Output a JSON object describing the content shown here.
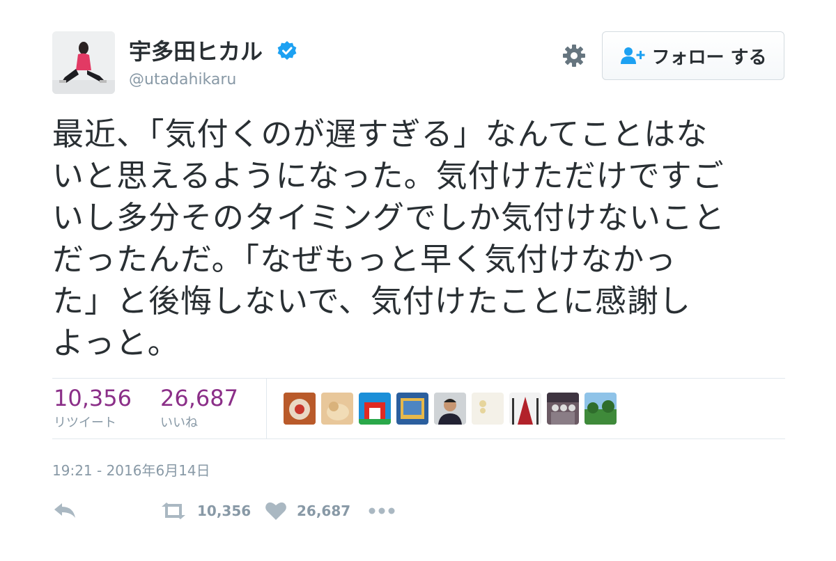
{
  "user": {
    "display_name": "宇多田ヒカル",
    "handle": "@utadahikaru",
    "verified": true
  },
  "follow_button": {
    "label": "フォロー する"
  },
  "tweet": {
    "lines": [
      "最近、「気付くのが遅すぎる」なんてことはな",
      "いと思えるようになった。気付けただけですご",
      "いし多分そのタイミングでしか気付けないこと",
      "だったんだ。「なぜもっと早く気付けなかっ",
      "た」と後悔しないで、気付けたことに感謝し",
      "よっと。"
    ]
  },
  "stats": {
    "retweets": {
      "count": "10,356",
      "label": "リツイート"
    },
    "likes": {
      "count": "26,687",
      "label": "いいね"
    }
  },
  "likers_count_shown": 9,
  "timestamp": "19:21 - 2016年6月14日",
  "actions": {
    "retweet_count": "10,356",
    "like_count": "26,687"
  },
  "colors": {
    "stat_number": "#8b2f88",
    "muted_text": "#8899a6",
    "verified_badge": "#1da1f2"
  },
  "icons": [
    "verified-badge-icon",
    "gear-icon",
    "follow-user-icon",
    "reply-icon",
    "retweet-icon",
    "like-heart-icon",
    "more-dots-icon"
  ]
}
